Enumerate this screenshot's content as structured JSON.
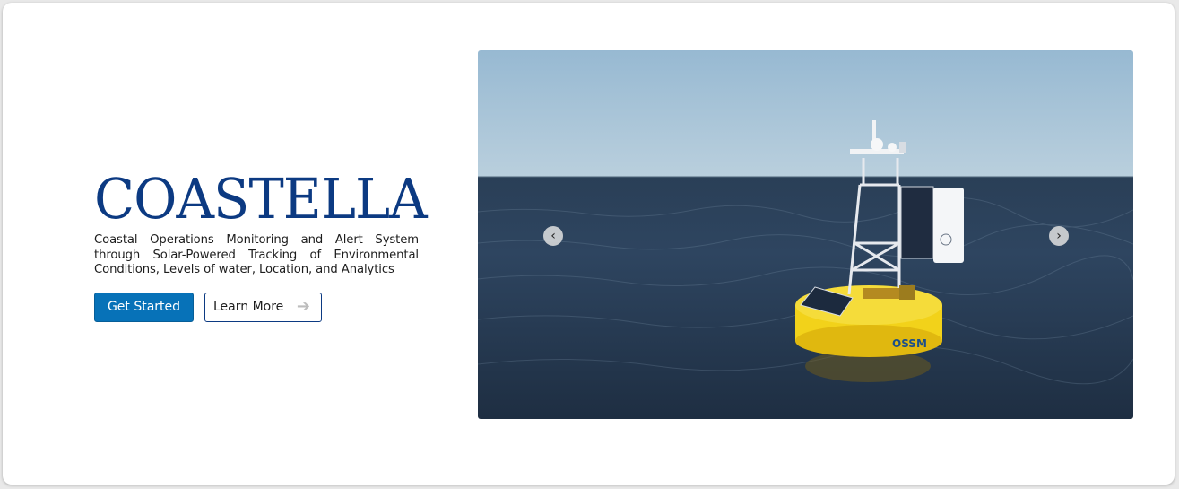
{
  "hero": {
    "brand": "COASTELLA",
    "tagline": "Coastal Operations Monitoring and Alert System through Solar-Powered Tracking of Environmental Conditions, Levels of water, Location, and Analytics",
    "primary_button": "Get Started",
    "secondary_button": "Learn More",
    "secondary_icon": "arrow-right-icon"
  },
  "carousel": {
    "image": "buoy-photo",
    "buoy_label": "OSSM",
    "prev_icon": "chevron-left-icon",
    "next_icon": "chevron-right-icon",
    "prev_glyph": "‹",
    "next_glyph": "›"
  },
  "colors": {
    "brand": "#0c3a82",
    "primary": "#0772b8",
    "sea": "#2e4560",
    "buoy": "#f2d21a"
  }
}
